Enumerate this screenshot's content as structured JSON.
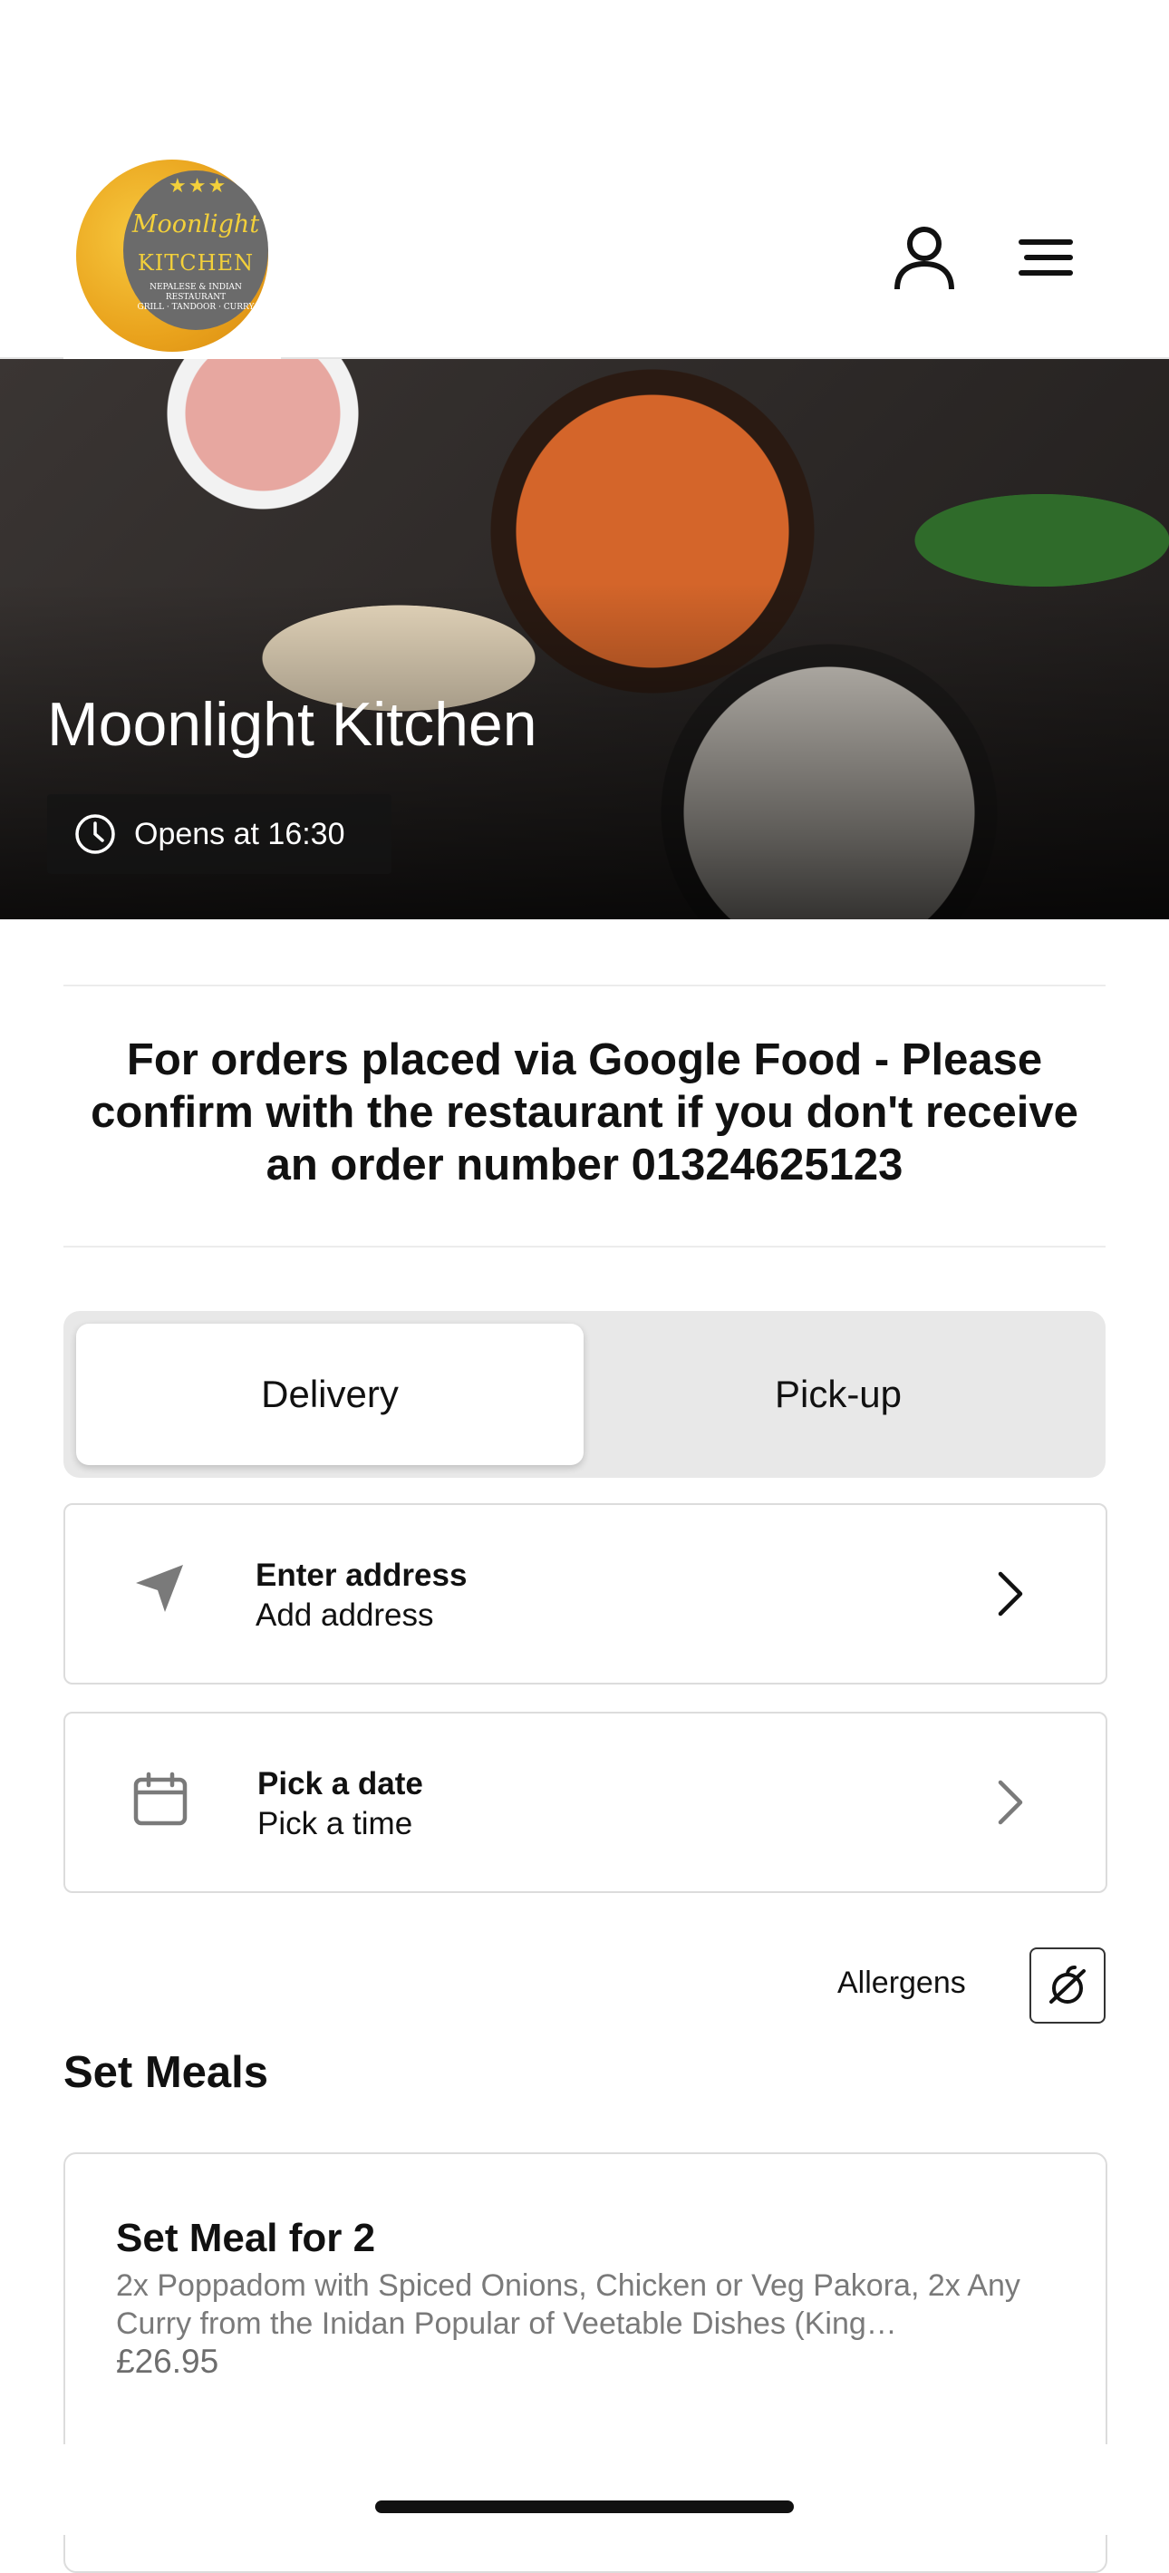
{
  "restaurant": {
    "name": "Moonlight Kitchen",
    "opens": "Opens at 16:30",
    "logo": {
      "line1": "Moonlight",
      "line2": "KITCHEN",
      "line3": "NEPALESE & INDIAN RESTAURANT",
      "line4": "GRILL · TANDOOR · CURRY"
    }
  },
  "notice": "For orders placed via Google Food - Please confirm with the restaurant if you don't receive an order number 01324625123",
  "tabs": {
    "delivery": "Delivery",
    "pickup": "Pick-up",
    "selected": "delivery"
  },
  "address_card": {
    "title": "Enter address",
    "subtitle": "Add address"
  },
  "date_card": {
    "title": "Pick a date",
    "subtitle": "Pick a time"
  },
  "allergens_label": "Allergens",
  "section": {
    "title": "Set Meals"
  },
  "meal": {
    "title": "Set Meal for 2",
    "description": "2x Poppadom with Spiced Onions, Chicken or Veg Pakora, 2x Any Curry from the Inidan Popular of Veetable Dishes  (King…",
    "price": "£26.95"
  },
  "icons": {
    "account": "user-icon",
    "menu": "hamburger-icon",
    "clock": "clock-icon",
    "location": "location-arrow-icon",
    "calendar": "calendar-icon",
    "chevron": "chevron-right-icon",
    "allergens": "allergen-icon"
  }
}
